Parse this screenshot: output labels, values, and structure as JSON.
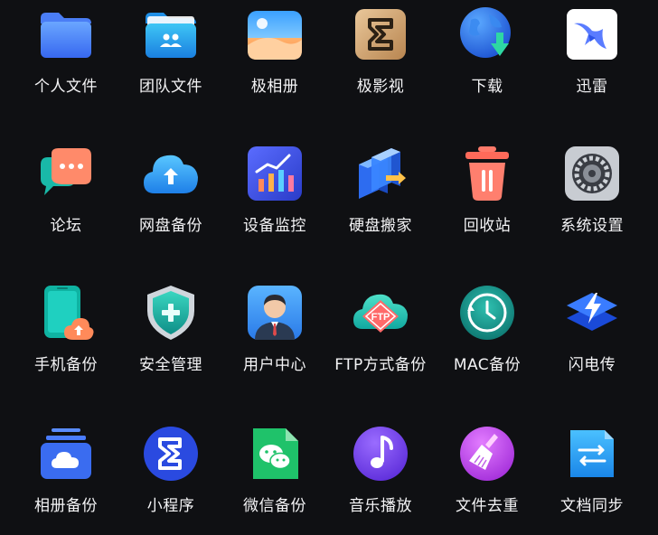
{
  "apps": [
    {
      "label": "个人文件",
      "icon": "folder-icon"
    },
    {
      "label": "团队文件",
      "icon": "team-folder-icon"
    },
    {
      "label": "极相册",
      "icon": "photo-album-icon"
    },
    {
      "label": "极影视",
      "icon": "video-icon"
    },
    {
      "label": "下载",
      "icon": "download-globe-icon"
    },
    {
      "label": "迅雷",
      "icon": "thunder-bird-icon"
    },
    {
      "label": "论坛",
      "icon": "forum-chat-icon"
    },
    {
      "label": "网盘备份",
      "icon": "cloud-upload-icon"
    },
    {
      "label": "设备监控",
      "icon": "chart-monitor-icon"
    },
    {
      "label": "硬盘搬家",
      "icon": "disk-migrate-icon"
    },
    {
      "label": "回收站",
      "icon": "trash-icon"
    },
    {
      "label": "系统设置",
      "icon": "gear-icon"
    },
    {
      "label": "手机备份",
      "icon": "phone-backup-icon"
    },
    {
      "label": "安全管理",
      "icon": "shield-icon"
    },
    {
      "label": "用户中心",
      "icon": "user-icon"
    },
    {
      "label": "FTP方式备份",
      "icon": "ftp-cloud-icon"
    },
    {
      "label": "MAC备份",
      "icon": "time-machine-icon"
    },
    {
      "label": "闪电传",
      "icon": "lightning-icon"
    },
    {
      "label": "相册备份",
      "icon": "album-cloud-icon"
    },
    {
      "label": "小程序",
      "icon": "mini-program-icon"
    },
    {
      "label": "微信备份",
      "icon": "wechat-icon"
    },
    {
      "label": "音乐播放",
      "icon": "music-icon"
    },
    {
      "label": "文件去重",
      "icon": "broom-icon"
    },
    {
      "label": "文档同步",
      "icon": "doc-sync-icon"
    }
  ]
}
